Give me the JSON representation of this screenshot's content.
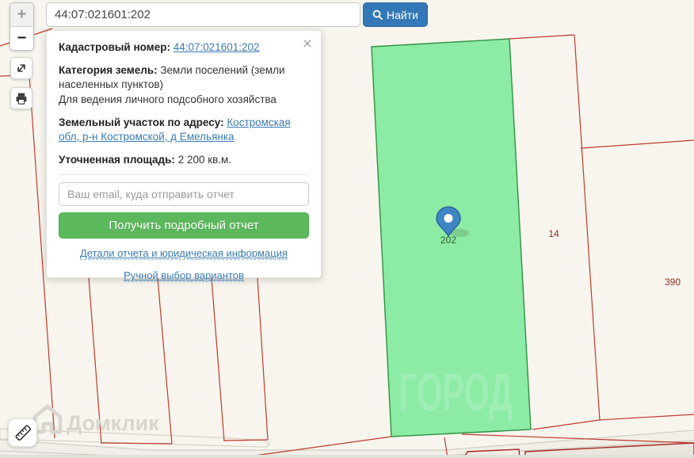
{
  "search_bar": {
    "query": "44:07:021601:202",
    "find_button": "Найти"
  },
  "zoom_controls": {
    "zoom_in": "+",
    "zoom_out": "−"
  },
  "popup": {
    "close": "×",
    "cadastral": {
      "label": "Кадастровый номер:",
      "number": "44:07:021601:202"
    },
    "category": {
      "label": "Категория земель:",
      "value": "Земли поселений (земли населенных пунктов)",
      "note": "Для ведения личного подсобного хозяйства"
    },
    "address": {
      "label": "Земельный участок по адресу:",
      "value": "Костромская обл, р-н Костромской, д Емельянка"
    },
    "area": {
      "label": "Уточненная площадь:",
      "value": "2 200 кв.м."
    },
    "email": {
      "placeholder": "Ваш email, куда отправить отчет"
    },
    "report_button": "Получить подробный отчет",
    "links": {
      "details": "Детали отчета и юридическая информация",
      "manual": "Ручной выбор вариантов"
    }
  },
  "map": {
    "selected_parcel_label": "202",
    "parcel_labels": {
      "right": "14",
      "far_right": "390"
    },
    "watermarks": {
      "city": "ГОРОД",
      "brand": "Домклик"
    },
    "colors": {
      "map_background": "#f8f5ee",
      "selected_parcel_fill": "#8ceba5",
      "selected_parcel_outline": "#2e9140",
      "boundary_red": "#bf3b2b",
      "parcel_label_red": "#8f2a20",
      "marker_blue": "#3f86c6",
      "find_button_blue": "#3478b7",
      "report_button_green": "#5cb85c",
      "link_blue": "#3a7ab5",
      "watermark_gray": "#d8d6d0",
      "watermark_green": "#a0efb7"
    }
  }
}
